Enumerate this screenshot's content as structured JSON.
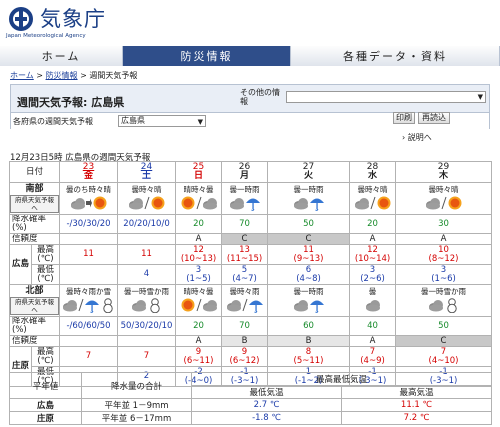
{
  "header": {
    "title": "気象庁",
    "subtitle": "Japan Meteorological Agency"
  },
  "nav": [
    {
      "label": "ホーム",
      "active": false
    },
    {
      "label": "防災情報",
      "active": true
    },
    {
      "label": "各種データ・資料",
      "active": false
    }
  ],
  "breadcrumb": {
    "home": "ホーム",
    "sep1": " > ",
    "disaster": "防災情報",
    "sep2": " > ",
    "current": "週間天気予報"
  },
  "panel": {
    "title": "週間天気予報: 広島県",
    "other_label": "その他の情報",
    "pref_label": "各府県の週間天気予報",
    "pref_value": "広島県",
    "print_label": "印刷",
    "reload_label": "再読込",
    "explain_label": "説明へ"
  },
  "caption": "12月23日5時  広島県の週間天気予報",
  "table": {
    "date_label": "日付",
    "days": [
      {
        "num": "23",
        "wd": "金",
        "color": "#d40000"
      },
      {
        "num": "24",
        "wd": "土",
        "color": "#1a3aa8"
      },
      {
        "num": "25",
        "wd": "日",
        "color": "#d40000"
      },
      {
        "num": "26",
        "wd": "月",
        "color": "#222222"
      },
      {
        "num": "27",
        "wd": "火",
        "color": "#222222"
      },
      {
        "num": "28",
        "wd": "水",
        "color": "#222222"
      },
      {
        "num": "29",
        "wd": "木",
        "color": "#222222"
      }
    ],
    "row_labels": {
      "precip": "降水確率(%)",
      "reliability": "信頼度",
      "max": "最高(℃)",
      "min": "最低(℃)",
      "region_btn": "府県天気予報へ"
    },
    "regions": [
      {
        "area": "南部",
        "city": "広島",
        "weather": [
          {
            "text": "曇のち時々晴",
            "icons": [
              "cloud",
              "arrow",
              "sun"
            ]
          },
          {
            "text": "曇時々晴",
            "icons": [
              "cloud",
              "slash",
              "sun"
            ]
          },
          {
            "text": "晴時々曇",
            "icons": [
              "sun",
              "slash",
              "cloud"
            ]
          },
          {
            "text": "曇一時雨",
            "icons": [
              "cloud",
              "umbrella"
            ]
          },
          {
            "text": "曇一時雨",
            "icons": [
              "cloud",
              "umbrella"
            ]
          },
          {
            "text": "曇時々晴",
            "icons": [
              "cloud",
              "slash",
              "sun"
            ]
          },
          {
            "text": "曇時々晴",
            "icons": [
              "cloud",
              "slash",
              "sun"
            ]
          }
        ],
        "precip": [
          "-/30/30/20",
          "20/20/10/0",
          "20",
          "70",
          "50",
          "20",
          "30"
        ],
        "reliability": [
          "",
          "",
          "A",
          "C",
          "C",
          "A",
          "A"
        ],
        "max": [
          "11",
          "11",
          "12",
          "13",
          "11",
          "12",
          "10"
        ],
        "max_range": [
          "",
          "",
          "(10~13)",
          "(11~15)",
          "(9~13)",
          "(10~14)",
          "(8~12)"
        ],
        "min": [
          "",
          "4",
          "3",
          "5",
          "6",
          "3",
          "3"
        ],
        "min_range": [
          "",
          "",
          "(1~5)",
          "(4~7)",
          "(4~8)",
          "(2~6)",
          "(1~6)"
        ]
      },
      {
        "area": "北部",
        "city": "庄原",
        "weather": [
          {
            "text": "曇時々雨か雪",
            "icons": [
              "cloud",
              "slash",
              "umbrella",
              "snowman"
            ]
          },
          {
            "text": "曇一時雪か雨",
            "icons": [
              "cloud",
              "snowman"
            ]
          },
          {
            "text": "晴時々曇",
            "icons": [
              "sun",
              "slash",
              "cloud"
            ]
          },
          {
            "text": "曇時々雨",
            "icons": [
              "cloud",
              "slash",
              "umbrella"
            ]
          },
          {
            "text": "曇一時雨",
            "icons": [
              "cloud",
              "umbrella"
            ]
          },
          {
            "text": "曇",
            "icons": [
              "cloud"
            ]
          },
          {
            "text": "曇一時雪か雨",
            "icons": [
              "cloud",
              "snowman"
            ]
          }
        ],
        "precip": [
          "-/60/60/50",
          "50/30/20/10",
          "20",
          "70",
          "60",
          "40",
          "50"
        ],
        "reliability": [
          "",
          "",
          "A",
          "B",
          "B",
          "A",
          "C"
        ],
        "max": [
          "7",
          "7",
          "9",
          "9",
          "8",
          "7",
          "7"
        ],
        "max_range": [
          "",
          "",
          "(6~11)",
          "(6~12)",
          "(5~11)",
          "(4~9)",
          "(4~10)"
        ],
        "min": [
          "",
          "2",
          "-2",
          "-1",
          "1",
          "-1",
          "-1"
        ],
        "min_range": [
          "",
          "",
          "(-4~0)",
          "(-3~1)",
          "(-1~2)",
          "(-3~1)",
          "(-3~1)"
        ]
      }
    ]
  },
  "normals": {
    "head": {
      "label": "平年値",
      "precip": "降水量の合計",
      "temp_head": "最高最低気温",
      "min_head": "最低気温",
      "max_head": "最高気温"
    },
    "rows": [
      {
        "city": "広島",
        "precip": "平年並 1－9mm",
        "min": "2.7 ℃",
        "max": "11.1 ℃"
      },
      {
        "city": "庄原",
        "precip": "平年並 6－17mm",
        "min": "-1.8 ℃",
        "max": "7.2 ℃"
      }
    ]
  }
}
